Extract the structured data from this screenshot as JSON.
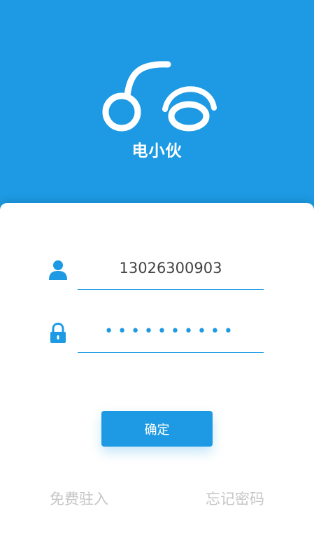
{
  "header": {
    "app_name": "电小伙",
    "logo_icon": "scooter-logo-icon",
    "background_color": "#1d9ae3"
  },
  "login": {
    "phone_value": "13026300903",
    "password_value": "••••••••••",
    "user_icon": "user-icon",
    "lock_icon": "lock-icon",
    "accent_color": "#1d9ae3"
  },
  "actions": {
    "confirm_label": "确定",
    "join_label": "免费驻入",
    "forgot_label": "忘记密码"
  }
}
